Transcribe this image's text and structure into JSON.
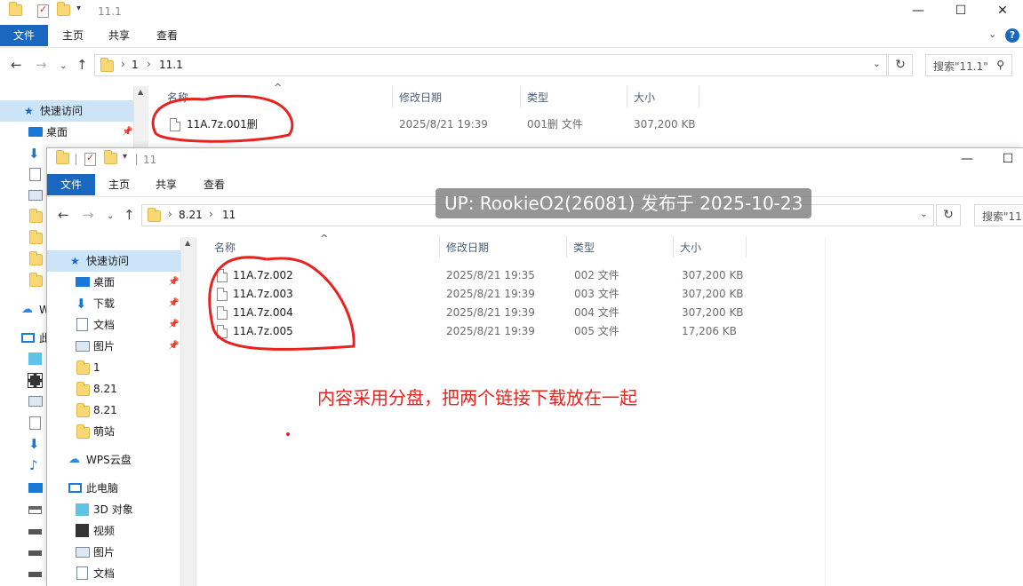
{
  "back_window": {
    "title": "11.1",
    "ribbon_tabs": [
      "文件",
      "主页",
      "共享",
      "查看"
    ],
    "breadcrumb": [
      "1",
      "11.1"
    ],
    "search_placeholder": "搜索\"11.1\"",
    "sidebar": {
      "quick_access": "快速访问",
      "items": [
        "桌面",
        "W",
        "此"
      ]
    },
    "columns": [
      "名称",
      "修改日期",
      "类型",
      "大小"
    ],
    "rows": [
      {
        "name": "11A.7z.001删",
        "date": "2025/8/21 19:39",
        "type": "001删 文件",
        "size": "307,200 KB"
      }
    ]
  },
  "front_window": {
    "title": "11",
    "ribbon_tabs": [
      "文件",
      "主页",
      "共享",
      "查看"
    ],
    "breadcrumb": [
      "8.21",
      "11"
    ],
    "search_placeholder": "搜索\"11\"",
    "sidebar": {
      "quick_access": "快速访问",
      "items": [
        "桌面",
        "下载",
        "文档",
        "图片",
        "1",
        "8.21",
        "8.21",
        "萌站"
      ],
      "wps": "WPS云盘",
      "this_pc": "此电脑",
      "pc_items": [
        "3D 对象",
        "视频",
        "图片",
        "文档"
      ]
    },
    "columns": [
      "名称",
      "修改日期",
      "类型",
      "大小"
    ],
    "rows": [
      {
        "name": "11A.7z.002",
        "date": "2025/8/21 19:35",
        "type": "002 文件",
        "size": "307,200 KB"
      },
      {
        "name": "11A.7z.003",
        "date": "2025/8/21 19:39",
        "type": "003 文件",
        "size": "307,200 KB"
      },
      {
        "name": "11A.7z.004",
        "date": "2025/8/21 19:39",
        "type": "004 文件",
        "size": "307,200 KB"
      },
      {
        "name": "11A.7z.005",
        "date": "2025/8/21 19:39",
        "type": "005 文件",
        "size": "17,206 KB"
      }
    ]
  },
  "watermark": "UP: RookieO2(26081) 发布于 2025-10-23",
  "annotation": "内容采用分盘，把两个链接下载放在一起",
  "colors": {
    "accent": "#1a67bf",
    "annotation_red": "#e8231f",
    "selection": "#cce4f7"
  }
}
